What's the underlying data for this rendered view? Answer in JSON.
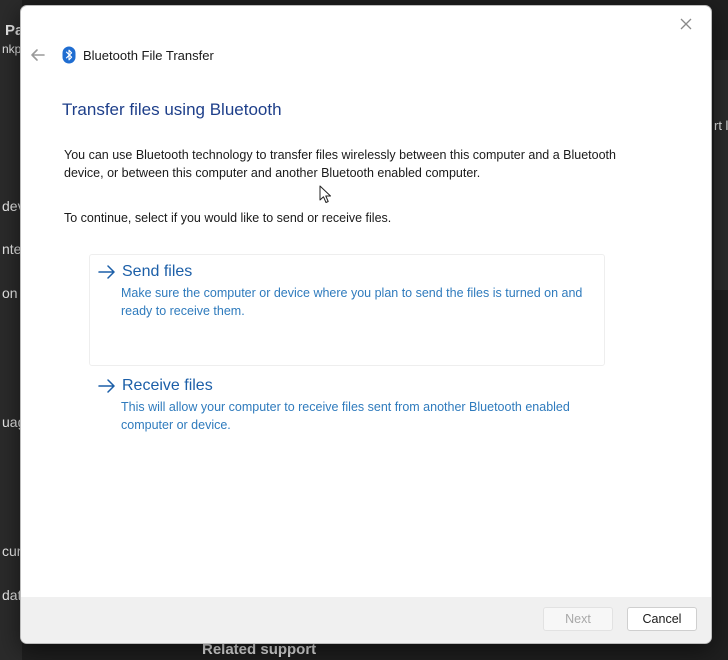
{
  "background": {
    "header_fragment_1": "Pa",
    "header_fragment_2": "nkp",
    "right_fragment": "rt l",
    "sidebar_fragments": [
      "dev",
      "nte",
      "on",
      "uag",
      "cur",
      "dat"
    ],
    "related_support": "Related support"
  },
  "dialog": {
    "window_title": "Bluetooth File Transfer",
    "heading": "Transfer files using Bluetooth",
    "description": "You can use Bluetooth technology to transfer files wirelessly between this computer and a Bluetooth device, or between this computer and another Bluetooth enabled computer.",
    "instruction": "To continue, select if you would like to send or receive files.",
    "options": [
      {
        "label": "Send files",
        "description": "Make sure the computer or device where you plan to send the files is turned on and ready to receive them."
      },
      {
        "label": "Receive files",
        "description": "This will allow your computer to receive files sent from another Bluetooth enabled computer or device."
      }
    ],
    "buttons": {
      "next": "Next",
      "cancel": "Cancel"
    },
    "icons": {
      "close": "close-icon",
      "back": "back-arrow-icon",
      "bluetooth": "bluetooth-icon",
      "option_arrow": "right-arrow-icon"
    }
  },
  "colors": {
    "heading": "#1e3f8a",
    "link": "#1c5fa8",
    "link_description": "#2f7bbd",
    "bluetooth_badge": "#1f6dd1"
  }
}
